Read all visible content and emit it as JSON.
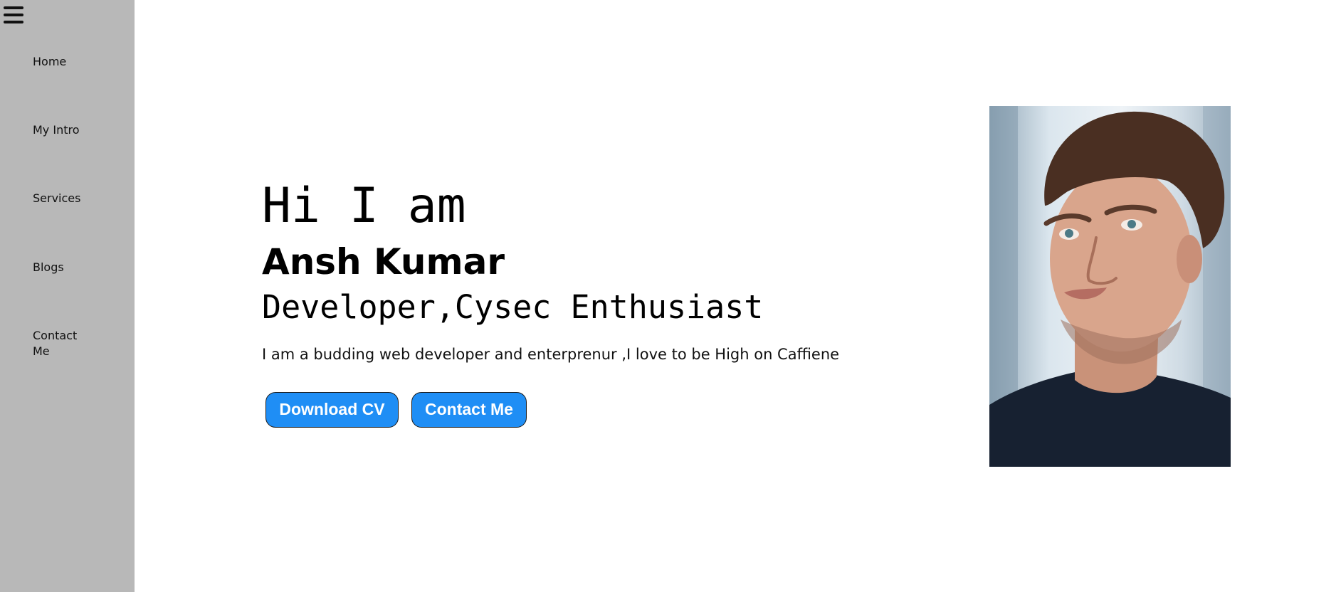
{
  "sidebar": {
    "items": [
      {
        "label": "Home"
      },
      {
        "label": "My Intro"
      },
      {
        "label": "Services"
      },
      {
        "label": "Blogs"
      },
      {
        "label": "Contact Me"
      }
    ]
  },
  "hero": {
    "greeting": "Hi I am",
    "name": "Ansh Kumar",
    "role": "Developer,Cysec Enthusiast",
    "bio": "I am a budding web developer and enterprenur ,I love to be High on Caffiene",
    "buttons": {
      "download_cv": "Download CV",
      "contact_me": "Contact Me"
    }
  },
  "colors": {
    "sidebar_bg": "#b8b8b8",
    "button_bg": "#1f8ef5",
    "button_text": "#ffffff"
  },
  "icons": {
    "menu": "hamburger-menu-icon"
  }
}
